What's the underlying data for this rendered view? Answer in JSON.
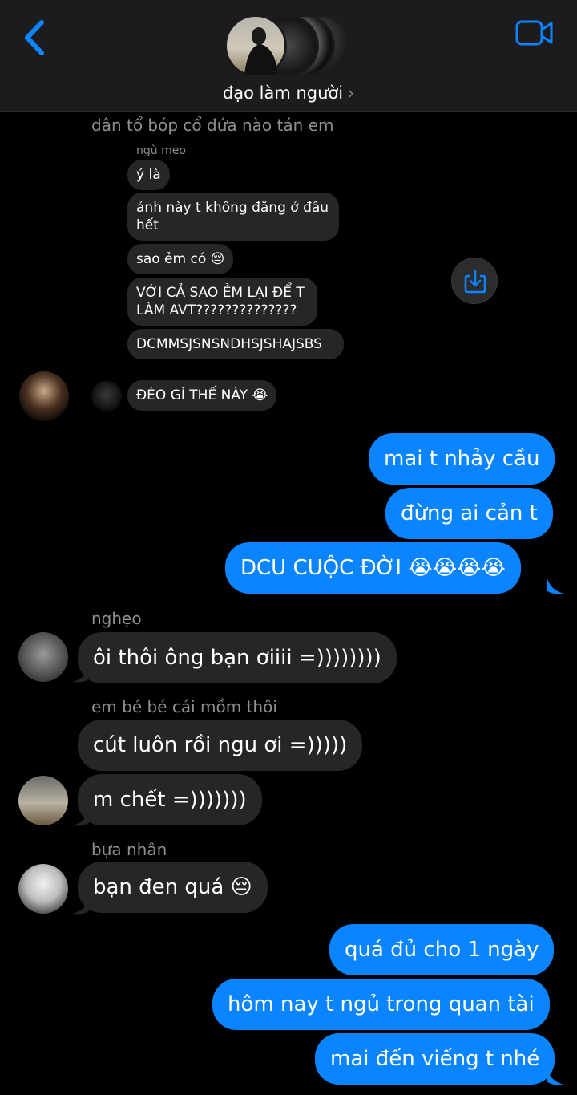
{
  "header": {
    "title": "đạo làm người",
    "chevron": "›",
    "back_icon": "chevron-left-icon",
    "video_icon": "video-camera-icon",
    "accent_color": "#0a84ff"
  },
  "quoted_reply": {
    "context_text": "dân tổ bóp cổ đứa nào tán em",
    "sender": "ngù meo",
    "messages": [
      "ý là",
      "ảnh này t không đăng ở đâu hết",
      "sao ẻm có 😔",
      "VỚI CẢ SAO ẺM LẠI ĐỂ T LÀM AVT??????????????",
      "DCMMSJSNSNDHSJSHAJSBS",
      "ĐÉO GÌ THẾ NÀY 😭"
    ]
  },
  "messages": [
    {
      "dir": "out",
      "text": "mai t nhảy cầu"
    },
    {
      "dir": "out",
      "text": "đừng ai cản t"
    },
    {
      "dir": "out",
      "text": "DCU CUỘC ĐỜI 😭😭😭😭"
    },
    {
      "dir": "in",
      "sender": "nghẹo",
      "text": "ôi thôi ông bạn ơiiii =))))))))"
    },
    {
      "dir": "in",
      "sender": "em bé bé cái mồm thôi",
      "text": "cút luôn rồi ngu ơi =)))))"
    },
    {
      "dir": "in",
      "text": "m chết =)))))))"
    },
    {
      "dir": "in",
      "sender": "bựa nhân",
      "text": "bạn đen quá 😔"
    },
    {
      "dir": "out",
      "text": "quá đủ cho 1 ngày"
    },
    {
      "dir": "out",
      "text": "hôm nay t ngủ trong quan tài"
    },
    {
      "dir": "out",
      "text": "mai đến viếng t nhé"
    }
  ],
  "save_icon": "save-download-icon"
}
